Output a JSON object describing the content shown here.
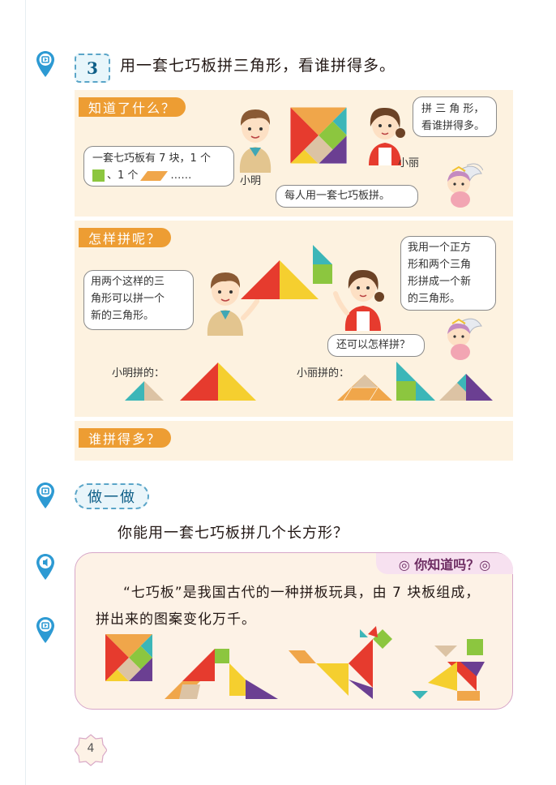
{
  "problem": {
    "number": "3",
    "title": "用一套七巧板拼三角形，看谁拼得多。"
  },
  "section1": {
    "label": "知道了什么？",
    "bubble_line1": "一套七巧板有 7 块，1 个",
    "bubble_line2_a": "、1 个",
    "bubble_line2_b": "……",
    "name_boy": "小明",
    "name_girl": "小丽",
    "girl_bubble_line1": "拼 三 角 形，",
    "girl_bubble_line2": "看谁拼得多。",
    "angel_bubble": "每人用一套七巧板拼。"
  },
  "section2": {
    "label": "怎样拼呢？",
    "boy_bubble": [
      "用两个这样的三",
      "角形可以拼一个",
      "新的三角形。"
    ],
    "girl_bubble": [
      "我用一个正方",
      "形和两个三角",
      "形拼成一个新",
      "的三角形。"
    ],
    "angel_bubble": "还可以怎样拼？",
    "boy_result_label": "小明拼的：",
    "girl_result_label": "小丽拼的："
  },
  "section3": {
    "label": "谁拼得多？"
  },
  "activity": {
    "badge": "做一做",
    "question": "你能用一套七巧板拼几个长方形？"
  },
  "did_you_know": {
    "tag": "◎ 你知道吗？◎",
    "text": "“七巧板”是我国古代的一种拼板玩具，由 7 块板组成，拼出来的图案变化万千。"
  },
  "page_number": "4",
  "colors": {
    "orange_label": "#ed9d33",
    "panel_bg": "#fdf2e0",
    "red": "#e63b2e",
    "yellow": "#f5cf2f",
    "green": "#8cc63f",
    "teal": "#3cb6b8",
    "purple": "#6b3f92",
    "orange": "#f0a64a",
    "tan": "#dcc3a4",
    "pin_blue": "#2d9ad3"
  }
}
